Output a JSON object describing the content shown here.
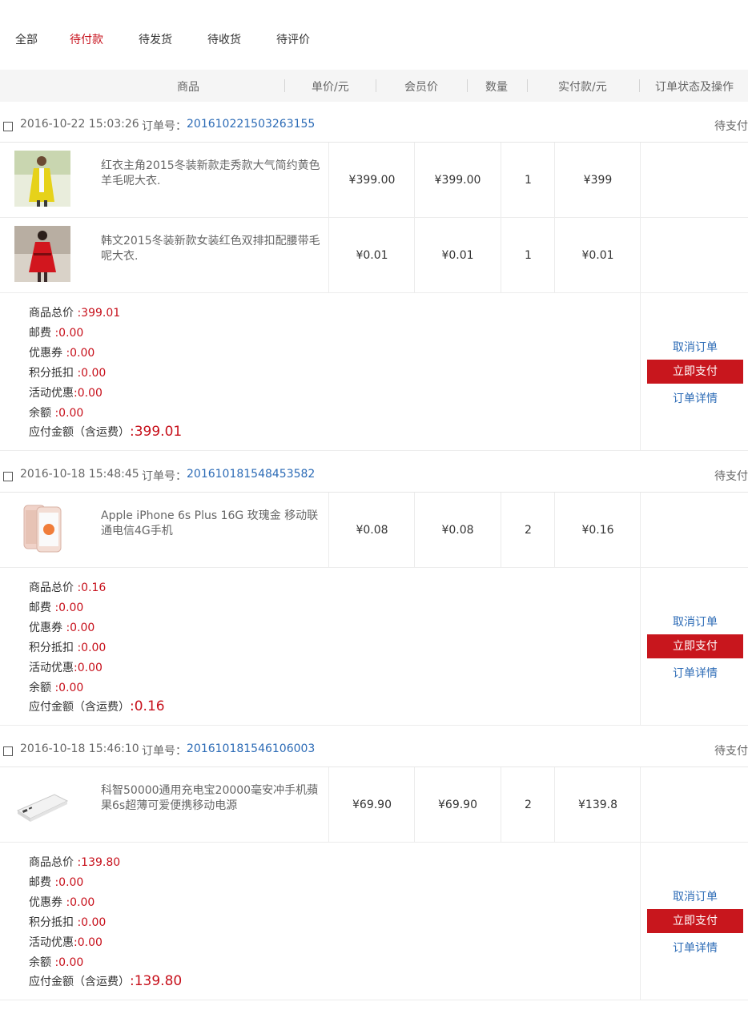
{
  "tabs": [
    "全部",
    "待付款",
    "待发货",
    "待收货",
    "待评价"
  ],
  "columns": [
    "商品",
    "单价/元",
    "会员价",
    "数量",
    "实付款/元",
    "订单状态及操作"
  ],
  "summary_labels": {
    "total": "商品总价",
    "shipping": "邮费",
    "coupon": "优惠券",
    "points": "积分抵扣",
    "promo": "活动优惠",
    "balance": "余额",
    "payable": "应付金额（含运费）"
  },
  "actions": {
    "cancel": "取消订单",
    "pay": "立即支付",
    "detail": "订单详情"
  },
  "orders": [
    {
      "date": "2016-10-22 15:03:26",
      "order_label": "订单号：",
      "order_no": "201610221503263155",
      "status": "待支付",
      "items": [
        {
          "name": "红衣主角2015冬装新款走秀款大气简约黄色羊毛呢大衣.",
          "price": "¥399.00",
          "member_price": "¥399.00",
          "qty": "1",
          "paid": "¥399",
          "image": "yellow-coat-photo"
        },
        {
          "name": "韩文2015冬装新款女装红色双排扣配腰带毛呢大衣.",
          "price": "¥0.01",
          "member_price": "¥0.01",
          "qty": "1",
          "paid": "¥0.01",
          "image": "red-coat-photo"
        }
      ],
      "summary": {
        "total": ":399.01",
        "shipping": ":0.00",
        "coupon": ":0.00",
        "points": ":0.00",
        "promo": ":0.00",
        "balance": ":0.00",
        "payable": ":399.01"
      }
    },
    {
      "date": "2016-10-18 15:48:45",
      "order_label": "订单号：",
      "order_no": "201610181548453582",
      "status": "待支付",
      "items": [
        {
          "name": "Apple iPhone 6s Plus 16G 玫瑰金 移动联通电信4G手机",
          "price": "¥0.08",
          "member_price": "¥0.08",
          "qty": "2",
          "paid": "¥0.16",
          "image": "iphone-photo"
        }
      ],
      "summary": {
        "total": ":0.16",
        "shipping": ":0.00",
        "coupon": ":0.00",
        "points": ":0.00",
        "promo": ":0.00",
        "balance": ":0.00",
        "payable": ":0.16"
      }
    },
    {
      "date": "2016-10-18 15:46:10",
      "order_label": "订单号：",
      "order_no": "201610181546106003",
      "status": "待支付",
      "items": [
        {
          "name": "科智50000通用充电宝20000毫安冲手机蘋果6s超薄可爱便携移动电源",
          "price": "¥69.90",
          "member_price": "¥69.90",
          "qty": "2",
          "paid": "¥139.8",
          "image": "power-bank-photo"
        }
      ],
      "summary": {
        "total": ":139.80",
        "shipping": ":0.00",
        "coupon": ":0.00",
        "points": ":0.00",
        "promo": ":0.00",
        "balance": ":0.00",
        "payable": ":139.80"
      }
    }
  ],
  "colors": {
    "accent": "#c7101b",
    "link": "#2c6bb6",
    "pay_button": "#c8161d"
  }
}
